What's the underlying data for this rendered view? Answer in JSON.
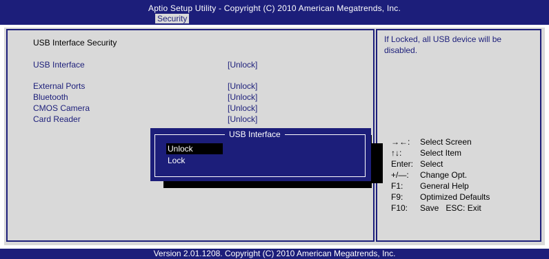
{
  "header": {
    "title": "Aptio Setup Utility - Copyright (C) 2010 American Megatrends, Inc.",
    "active_tab": "Security"
  },
  "settings": {
    "section_title": "USB Interface Security",
    "items": [
      {
        "label": "USB Interface",
        "value": "[Unlock]"
      },
      {
        "label": "External Ports",
        "value": "[Unlock]"
      },
      {
        "label": "Bluetooth",
        "value": "[Unlock]"
      },
      {
        "label": "CMOS Camera",
        "value": "[Unlock]"
      },
      {
        "label": "Card Reader",
        "value": "[Unlock]"
      }
    ]
  },
  "help_text": "If Locked, all USB device will be disabled.",
  "keys": [
    {
      "key": "→←:",
      "desc": "Select Screen"
    },
    {
      "key": "↑↓:",
      "desc": "Select Item"
    },
    {
      "key": "Enter:",
      "desc": "Select"
    },
    {
      "key": "+/—:",
      "desc": "Change Opt."
    },
    {
      "key": "F1:",
      "desc": "General Help"
    },
    {
      "key": "F9:",
      "desc": "Optimized Defaults"
    },
    {
      "key": "F10:",
      "desc": "Save   ESC: Exit"
    }
  ],
  "popup": {
    "title": "USB Interface",
    "options": [
      "Unlock",
      "Lock"
    ],
    "selected": "Unlock"
  },
  "footer": "Version 2.01.1208. Copyright (C) 2010 American Megatrends, Inc.",
  "colors": {
    "bios_blue": "#1c1e7a",
    "panel_gray": "#d9d9d9"
  }
}
